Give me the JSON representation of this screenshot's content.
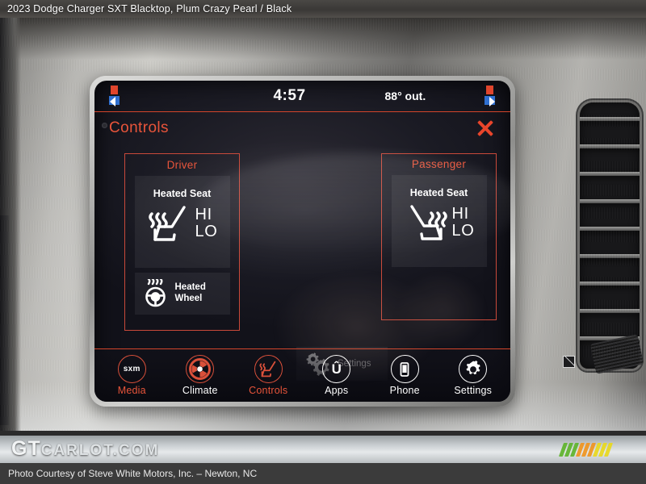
{
  "photo": {
    "header": "2023 Dodge Charger SXT Blacktop,  Plum Crazy Pearl / Black",
    "watermark_gt": "GT",
    "watermark_rest": "CARLOT.COM",
    "footer": "Photo Courtesy of Steve White Motors, Inc. – Newton, NC",
    "logo_colors": [
      "#5db32a",
      "#5db32a",
      "#5db32a",
      "#f0941e",
      "#f0941e",
      "#f0941e",
      "#e8d81c",
      "#e8d81c",
      "#e8d81c"
    ]
  },
  "screen": {
    "status": {
      "time": "4:57",
      "temperature": "88° out.",
      "left_indicator": "seat-climate-indicator",
      "right_indicator": "seat-climate-indicator"
    },
    "page_title": "Controls",
    "close_label": "close-icon",
    "zones": [
      {
        "name": "driver",
        "title": "Driver",
        "seat_tile": {
          "label": "Heated Seat",
          "levels": [
            "HI",
            "LO"
          ],
          "icon": "heated-seat-icon"
        },
        "wheel_tile": {
          "label_line1": "Heated",
          "label_line2": "Wheel",
          "icon": "heated-steering-wheel-icon"
        }
      },
      {
        "name": "passenger",
        "title": "Passenger",
        "seat_tile": {
          "label": "Heated Seat",
          "levels": [
            "HI",
            "LO"
          ],
          "icon": "heated-seat-icon"
        }
      }
    ],
    "settings_button": {
      "label": "Settings",
      "icon": "gears-icon"
    },
    "nav": [
      {
        "label": "Media",
        "icon": "sxm-icon",
        "badge": "sxm",
        "active": true,
        "style": "red"
      },
      {
        "label": "Climate",
        "icon": "climate-fan-icon",
        "active": false,
        "style": "red"
      },
      {
        "label": "Controls",
        "icon": "heated-seat-icon",
        "active": true,
        "style": "red"
      },
      {
        "label": "Apps",
        "icon": "apps-uconnect-icon",
        "badge": "Û",
        "active": false,
        "style": "white"
      },
      {
        "label": "Phone",
        "icon": "phone-icon",
        "active": false,
        "style": "white"
      },
      {
        "label": "Settings",
        "icon": "gear-icon",
        "active": false,
        "style": "white"
      }
    ],
    "colors": {
      "accent_red": "#e8543a",
      "border_red": "#d4452b",
      "text_white": "#ffffff",
      "screen_bg": "#16161e"
    }
  }
}
